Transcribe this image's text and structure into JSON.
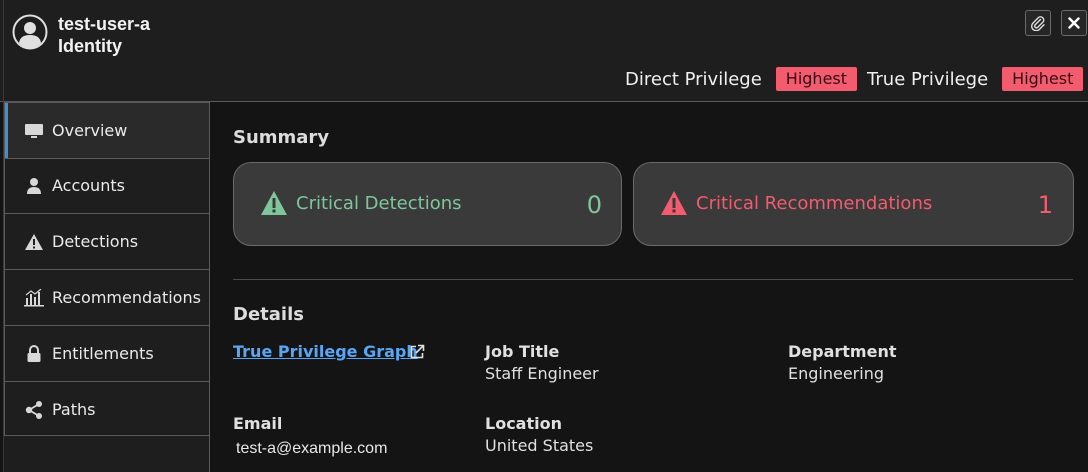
{
  "header": {
    "user_name": "test-user-a",
    "subtitle": "Identity",
    "direct_privilege_label": "Direct Privilege",
    "direct_privilege_value": "Highest",
    "true_privilege_label": "True Privilege",
    "true_privilege_value": "Highest",
    "badge_color": "#f25c6e"
  },
  "sidebar": {
    "items": [
      {
        "label": "Overview",
        "icon": "monitor-icon",
        "active": true
      },
      {
        "label": "Accounts",
        "icon": "person-icon"
      },
      {
        "label": "Detections",
        "icon": "warning-icon"
      },
      {
        "label": "Recommendations",
        "icon": "bar-chart-icon"
      },
      {
        "label": "Entitlements",
        "icon": "lock-icon"
      },
      {
        "label": "Paths",
        "icon": "share-icon"
      }
    ],
    "active_color": "#3d8fe0"
  },
  "summary": {
    "title": "Summary",
    "critical_detections_label": "Critical Detections",
    "critical_detections_count": "0",
    "critical_detections_color": "#7fc79a",
    "critical_recommendations_label": "Critical Recommendations",
    "critical_recommendations_count": "1",
    "critical_recommendations_color": "#f25c6e"
  },
  "details": {
    "title": "Details",
    "graph_link": "True Privilege Graph",
    "job_title_label": "Job Title",
    "job_title_value": "Staff Engineer",
    "department_label": "Department",
    "department_value": "Engineering",
    "email_label": "Email",
    "email_value": "test-a@example.com",
    "location_label": "Location",
    "location_value": "United States"
  }
}
